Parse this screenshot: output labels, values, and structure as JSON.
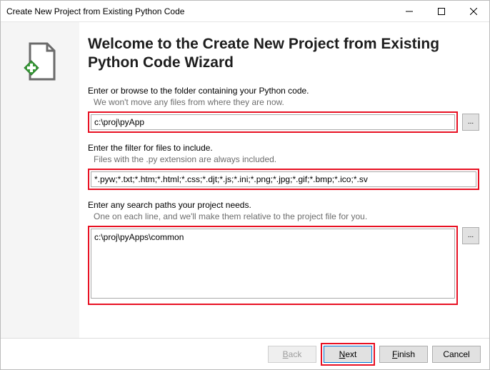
{
  "window": {
    "title": "Create New Project from Existing Python Code"
  },
  "wizard": {
    "heading": "Welcome to the Create New Project from Existing Python Code Wizard"
  },
  "folder": {
    "prompt": "Enter or browse to the folder containing your Python code.",
    "hint": "We won't move any files from where they are now.",
    "value": "c:\\proj\\pyApp",
    "browse": "..."
  },
  "filter": {
    "prompt": "Enter the filter for files to include.",
    "hint": "Files with the .py extension are always included.",
    "value": "*.pyw;*.txt;*.htm;*.html;*.css;*.djt;*.js;*.ini;*.png;*.jpg;*.gif;*.bmp;*.ico;*.sv"
  },
  "searchpaths": {
    "prompt": "Enter any search paths your project needs.",
    "hint": "One on each line, and we'll make them relative to the project file for you.",
    "value": "c:\\proj\\pyApps\\common",
    "browse": "..."
  },
  "buttons": {
    "back_prefix": "B",
    "back_rest": "ack",
    "next_prefix": "N",
    "next_rest": "ext",
    "finish_prefix": "F",
    "finish_rest": "inish",
    "cancel": "Cancel"
  }
}
